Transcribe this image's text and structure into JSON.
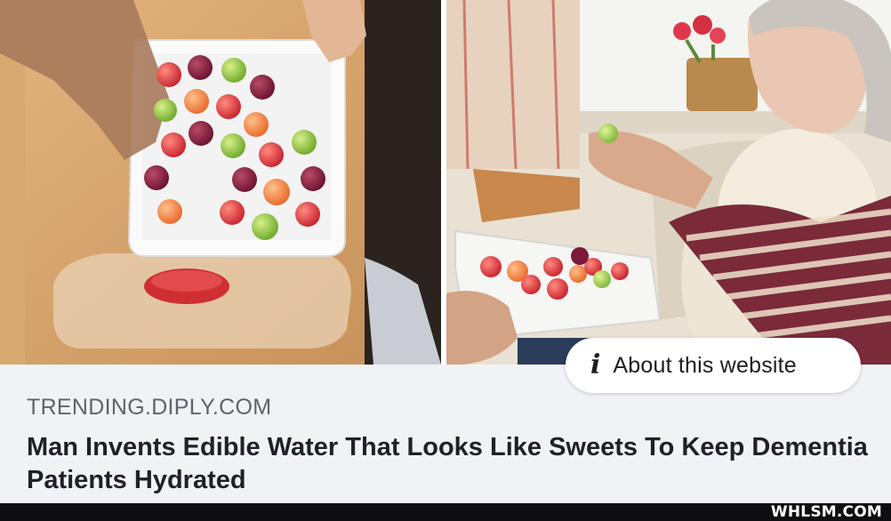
{
  "photos": {
    "left_alt": "hands arranging colourful edible water drops in a white tray",
    "right_alt": "elderly woman holding an edible water drop next to a tray"
  },
  "about": {
    "icon": "info-icon",
    "icon_glyph": "i",
    "label": "About this website"
  },
  "link": {
    "domain": "TRENDING.DIPLY.COM",
    "headline": "Man Invents Edible Water That Looks Like Sweets To Keep Dementia Patients Hydrated"
  },
  "watermark": {
    "text": "WHLSM.COM"
  },
  "colors": {
    "card_bg": "#f0f2f5",
    "headline": "#1d2129",
    "domain": "#5c6470",
    "drop_red": "#d8363b",
    "drop_orange": "#f07a3a",
    "drop_green": "#8fc23e",
    "drop_purple": "#7d1838"
  }
}
